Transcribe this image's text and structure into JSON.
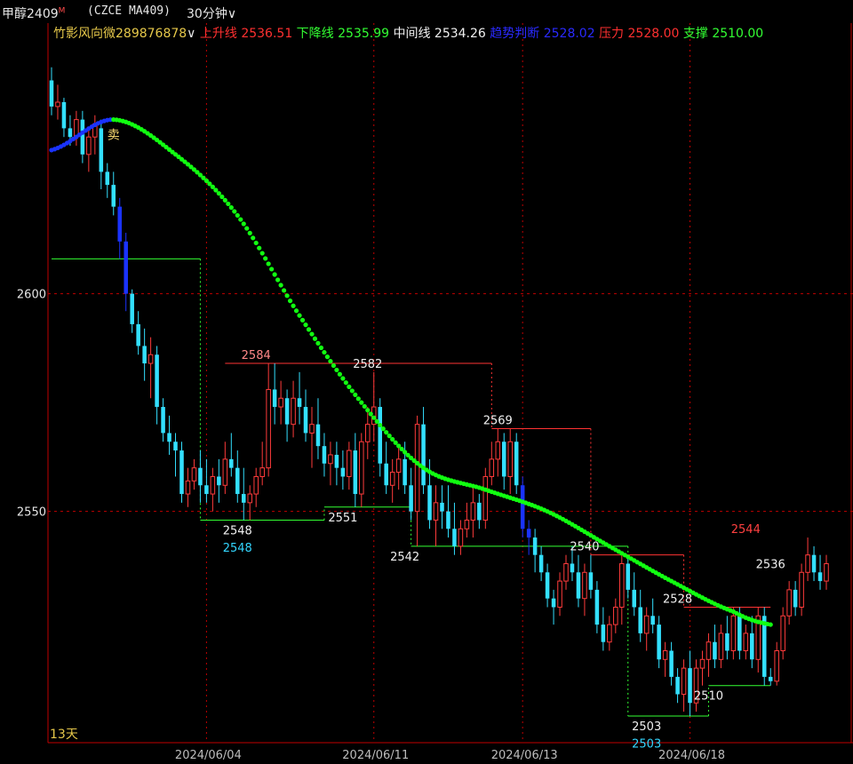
{
  "header": {
    "instrument": "甲醇2409",
    "marker": "M",
    "exchange_code": "(CZCE MA409)",
    "period": "30分钟",
    "period_caret": "∨"
  },
  "indicator_bar": {
    "name": "竹影风向微289876878",
    "caret": "∨",
    "items": [
      {
        "label": "上升线",
        "value": "2536.51",
        "color": "#ff3030"
      },
      {
        "label": "下降线",
        "value": "2535.99",
        "color": "#33ff33"
      },
      {
        "label": "中间线",
        "value": "2534.26",
        "color": "#f0f0f0"
      },
      {
        "label": "趋势判断",
        "value": "2528.02",
        "color": "#2a2aff"
      },
      {
        "label": "压力",
        "value": "2528.00",
        "color": "#ff3030"
      },
      {
        "label": "支撑",
        "value": "2510.00",
        "color": "#33ff33"
      }
    ]
  },
  "colors": {
    "up": "#ff3b3b",
    "down": "#33e0ff",
    "trend_down": "#11ff11",
    "trend_up": "#1a33ff",
    "resistance": "#ff3333",
    "support": "#33ff33",
    "grid": "#c00000"
  },
  "footer_label": "13天",
  "chart_data": {
    "type": "candlestick",
    "ylim": [
      2503,
      2654
    ],
    "y_ticks": [
      2600,
      2550
    ],
    "x_tick_labels": [
      {
        "index": 25,
        "label": "2024/06/04"
      },
      {
        "index": 52,
        "label": "2024/06/11"
      },
      {
        "index": 76,
        "label": "2024/06/13"
      },
      {
        "index": 103,
        "label": "2024/06/18"
      }
    ],
    "ohlc": [
      [
        2649,
        2652,
        2641,
        2643
      ],
      [
        2643,
        2648,
        2640,
        2644
      ],
      [
        2644,
        2645,
        2636,
        2638
      ],
      [
        2638,
        2641,
        2634,
        2636
      ],
      [
        2636,
        2642,
        2634,
        2640
      ],
      [
        2640,
        2642,
        2630,
        2632
      ],
      [
        2632,
        2638,
        2628,
        2636
      ],
      [
        2636,
        2641,
        2632,
        2639
      ],
      [
        2638,
        2640,
        2624,
        2628
      ],
      [
        2628,
        2630,
        2622,
        2625
      ],
      [
        2625,
        2628,
        2618,
        2620
      ],
      [
        2620,
        2622,
        2608,
        2612
      ],
      [
        2612,
        2614,
        2596,
        2600
      ],
      [
        2600,
        2601,
        2591,
        2593
      ],
      [
        2593,
        2596,
        2586,
        2588
      ],
      [
        2588,
        2592,
        2580,
        2584
      ],
      [
        2584,
        2590,
        2576,
        2586
      ],
      [
        2586,
        2588,
        2570,
        2574
      ],
      [
        2574,
        2576,
        2566,
        2568
      ],
      [
        2568,
        2572,
        2563,
        2566
      ],
      [
        2566,
        2568,
        2558,
        2564
      ],
      [
        2564,
        2566,
        2552,
        2554
      ],
      [
        2554,
        2560,
        2551,
        2557
      ],
      [
        2557,
        2562,
        2555,
        2560
      ],
      [
        2560,
        2564,
        2552,
        2556
      ],
      [
        2556,
        2562,
        2552,
        2554
      ],
      [
        2554,
        2560,
        2550,
        2558
      ],
      [
        2558,
        2562,
        2552,
        2556
      ],
      [
        2556,
        2566,
        2554,
        2562
      ],
      [
        2562,
        2568,
        2558,
        2560
      ],
      [
        2560,
        2564,
        2552,
        2554
      ],
      [
        2554,
        2560,
        2548,
        2552
      ],
      [
        2552,
        2556,
        2548,
        2554
      ],
      [
        2554,
        2560,
        2551,
        2558
      ],
      [
        2558,
        2566,
        2556,
        2560
      ],
      [
        2560,
        2584,
        2558,
        2578
      ],
      [
        2578,
        2584,
        2570,
        2574
      ],
      [
        2574,
        2580,
        2570,
        2576
      ],
      [
        2576,
        2578,
        2566,
        2570
      ],
      [
        2570,
        2580,
        2567,
        2576
      ],
      [
        2576,
        2582,
        2570,
        2574
      ],
      [
        2574,
        2578,
        2566,
        2568
      ],
      [
        2568,
        2574,
        2560,
        2570
      ],
      [
        2570,
        2576,
        2562,
        2565
      ],
      [
        2565,
        2568,
        2558,
        2561
      ],
      [
        2561,
        2566,
        2556,
        2563
      ],
      [
        2563,
        2566,
        2556,
        2560
      ],
      [
        2560,
        2564,
        2555,
        2558
      ],
      [
        2558,
        2566,
        2555,
        2564
      ],
      [
        2564,
        2568,
        2551,
        2554
      ],
      [
        2554,
        2568,
        2551,
        2566
      ],
      [
        2566,
        2574,
        2562,
        2570
      ],
      [
        2570,
        2582,
        2566,
        2574
      ],
      [
        2574,
        2576,
        2558,
        2561
      ],
      [
        2561,
        2566,
        2554,
        2556
      ],
      [
        2556,
        2562,
        2552,
        2559
      ],
      [
        2559,
        2565,
        2555,
        2562
      ],
      [
        2562,
        2566,
        2554,
        2556
      ],
      [
        2556,
        2560,
        2548,
        2550
      ],
      [
        2550,
        2572,
        2542,
        2570
      ],
      [
        2570,
        2574,
        2554,
        2556
      ],
      [
        2556,
        2562,
        2546,
        2548
      ],
      [
        2548,
        2556,
        2542,
        2552
      ],
      [
        2552,
        2556,
        2546,
        2550
      ],
      [
        2550,
        2556,
        2544,
        2546
      ],
      [
        2546,
        2552,
        2540,
        2542
      ],
      [
        2542,
        2548,
        2540,
        2546
      ],
      [
        2546,
        2552,
        2544,
        2548
      ],
      [
        2548,
        2556,
        2544,
        2552
      ],
      [
        2552,
        2554,
        2546,
        2548
      ],
      [
        2548,
        2560,
        2546,
        2558
      ],
      [
        2558,
        2566,
        2556,
        2562
      ],
      [
        2562,
        2569,
        2558,
        2566
      ],
      [
        2566,
        2568,
        2555,
        2558
      ],
      [
        2558,
        2569,
        2554,
        2566
      ],
      [
        2566,
        2568,
        2554,
        2556
      ],
      [
        2556,
        2558,
        2544,
        2546
      ],
      [
        2546,
        2548,
        2540,
        2544
      ],
      [
        2544,
        2546,
        2536,
        2540
      ],
      [
        2540,
        2542,
        2534,
        2536
      ],
      [
        2536,
        2538,
        2528,
        2530
      ],
      [
        2530,
        2532,
        2524,
        2528
      ],
      [
        2528,
        2536,
        2526,
        2534
      ],
      [
        2534,
        2540,
        2532,
        2538
      ],
      [
        2538,
        2542,
        2534,
        2536
      ],
      [
        2536,
        2540,
        2528,
        2530
      ],
      [
        2530,
        2538,
        2526,
        2536
      ],
      [
        2536,
        2540,
        2530,
        2532
      ],
      [
        2532,
        2534,
        2522,
        2524
      ],
      [
        2524,
        2528,
        2518,
        2520
      ],
      [
        2520,
        2526,
        2518,
        2524
      ],
      [
        2524,
        2530,
        2522,
        2528
      ],
      [
        2528,
        2540,
        2524,
        2538
      ],
      [
        2538,
        2540,
        2530,
        2532
      ],
      [
        2532,
        2536,
        2526,
        2528
      ],
      [
        2528,
        2532,
        2520,
        2522
      ],
      [
        2522,
        2528,
        2518,
        2526
      ],
      [
        2526,
        2530,
        2522,
        2524
      ],
      [
        2524,
        2526,
        2514,
        2516
      ],
      [
        2516,
        2520,
        2512,
        2518
      ],
      [
        2518,
        2520,
        2510,
        2512
      ],
      [
        2512,
        2514,
        2506,
        2508
      ],
      [
        2508,
        2516,
        2504,
        2514
      ],
      [
        2514,
        2518,
        2503,
        2506
      ],
      [
        2506,
        2516,
        2504,
        2514
      ],
      [
        2514,
        2518,
        2510,
        2516
      ],
      [
        2516,
        2522,
        2512,
        2520
      ],
      [
        2520,
        2524,
        2514,
        2516
      ],
      [
        2516,
        2524,
        2514,
        2522
      ],
      [
        2522,
        2526,
        2516,
        2518
      ],
      [
        2518,
        2528,
        2516,
        2526
      ],
      [
        2526,
        2528,
        2516,
        2518
      ],
      [
        2518,
        2524,
        2516,
        2522
      ],
      [
        2522,
        2526,
        2514,
        2516
      ],
      [
        2516,
        2528,
        2513,
        2526
      ],
      [
        2526,
        2528,
        2510,
        2512
      ],
      [
        2512,
        2514,
        2510,
        2511
      ],
      [
        2511,
        2520,
        2510,
        2518
      ],
      [
        2518,
        2528,
        2516,
        2526
      ],
      [
        2526,
        2534,
        2524,
        2532
      ],
      [
        2532,
        2534,
        2526,
        2528
      ],
      [
        2528,
        2538,
        2526,
        2536
      ],
      [
        2536,
        2544,
        2534,
        2540
      ],
      [
        2540,
        2542,
        2534,
        2536
      ],
      [
        2536,
        2540,
        2532,
        2534
      ],
      [
        2534,
        2540,
        2532,
        2538
      ]
    ],
    "strong_candles": [
      11,
      12,
      76,
      77
    ],
    "trend_line": [
      {
        "i": 0,
        "v": 2633
      },
      {
        "i": 10,
        "v": 2640
      },
      {
        "i": 20,
        "v": 2632
      },
      {
        "i": 30,
        "v": 2618
      },
      {
        "i": 40,
        "v": 2595
      },
      {
        "i": 50,
        "v": 2575
      },
      {
        "i": 60,
        "v": 2560
      },
      {
        "i": 70,
        "v": 2555
      },
      {
        "i": 80,
        "v": 2550
      },
      {
        "i": 90,
        "v": 2542
      },
      {
        "i": 100,
        "v": 2534
      },
      {
        "i": 110,
        "v": 2527
      },
      {
        "i": 116,
        "v": 2524
      }
    ],
    "trend_up_until_index": 10,
    "signal": {
      "index": 10,
      "text": "卖"
    },
    "resistance_levels": [
      {
        "from": 28,
        "to": 71,
        "value": 2584
      },
      {
        "from": 71,
        "to": 87,
        "value": 2569
      },
      {
        "from": 87,
        "to": 102,
        "value": 2540
      },
      {
        "from": 102,
        "to": 116,
        "value": 2528
      }
    ],
    "support_levels": [
      {
        "from": 0,
        "to": 24,
        "value": 2608
      },
      {
        "from": 24,
        "to": 44,
        "value": 2548
      },
      {
        "from": 44,
        "to": 58,
        "value": 2551
      },
      {
        "from": 58,
        "to": 93,
        "value": 2542
      },
      {
        "from": 93,
        "to": 106,
        "value": 2503
      },
      {
        "from": 106,
        "to": 116,
        "value": 2510
      }
    ],
    "price_labels": [
      {
        "index": 33,
        "value": 2584,
        "text": "2584",
        "color": "#ff8888",
        "pos": "above"
      },
      {
        "index": 51,
        "value": 2582,
        "text": "2582",
        "color": "#f0f0f0",
        "pos": "above"
      },
      {
        "index": 72,
        "value": 2569,
        "text": "2569",
        "color": "#f0f0f0",
        "pos": "above"
      },
      {
        "index": 30,
        "value": 2548,
        "text": "2548",
        "color": "#f0f0f0",
        "pos": "below"
      },
      {
        "index": 30,
        "value": 2544,
        "text": "2548",
        "color": "#33d6ff",
        "pos": "below"
      },
      {
        "index": 47,
        "value": 2551,
        "text": "2551",
        "color": "#f0f0f0",
        "pos": "below"
      },
      {
        "index": 57,
        "value": 2542,
        "text": "2542",
        "color": "#f0f0f0",
        "pos": "below"
      },
      {
        "index": 86,
        "value": 2540,
        "text": "2540",
        "color": "#f0f0f0",
        "pos": "above"
      },
      {
        "index": 101,
        "value": 2528,
        "text": "2528",
        "color": "#f0f0f0",
        "pos": "above"
      },
      {
        "index": 106,
        "value": 2510,
        "text": "2510",
        "color": "#f0f0f0",
        "pos": "below"
      },
      {
        "index": 96,
        "value": 2503,
        "text": "2503",
        "color": "#f0f0f0",
        "pos": "below"
      },
      {
        "index": 96,
        "value": 2499,
        "text": "2503",
        "color": "#33d6ff",
        "pos": "below"
      },
      {
        "index": 112,
        "value": 2544,
        "text": "2544",
        "color": "#ff4040",
        "pos": "above"
      },
      {
        "index": 116,
        "value": 2536,
        "text": "2536",
        "color": "#f0f0f0",
        "pos": "above"
      }
    ]
  }
}
